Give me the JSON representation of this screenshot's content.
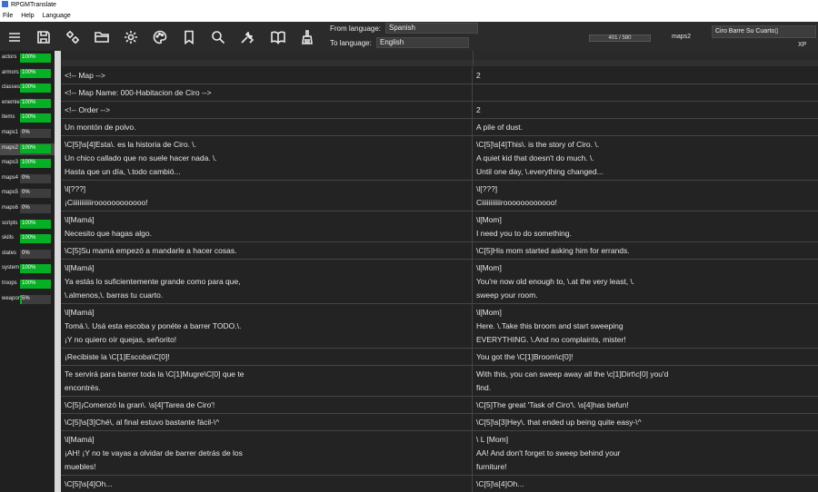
{
  "window": {
    "title": "RPGMTranslate"
  },
  "menu": [
    "File",
    "Help",
    "Language"
  ],
  "toolbar_icons": [
    "menu-icon",
    "save-icon",
    "tools-icon",
    "folder-icon",
    "gear-icon",
    "palette-icon",
    "bookmark-icon",
    "search-icon",
    "wrench-icon",
    "book-icon",
    "broom-icon"
  ],
  "language": {
    "from_label": "From language:",
    "from_value": "Spanish",
    "to_label": "To language:",
    "to_value": "English"
  },
  "progress": {
    "text": "401 / 580",
    "done": 401,
    "total": 580
  },
  "current_file": "maps2",
  "project": {
    "title": "Ciro Barre Su Cuarto▯",
    "engine": "XP"
  },
  "accent_color": "#06b025",
  "sidebar": [
    {
      "name": "actors",
      "pct": "100%",
      "value": 1.0
    },
    {
      "name": "armors",
      "pct": "100%",
      "value": 1.0
    },
    {
      "name": "classes",
      "pct": "100%",
      "value": 1.0
    },
    {
      "name": "enemies",
      "pct": "100%",
      "value": 1.0
    },
    {
      "name": "items",
      "pct": "100%",
      "value": 1.0
    },
    {
      "name": "maps1",
      "pct": "0%",
      "value": 0.0
    },
    {
      "name": "maps2",
      "pct": "100%",
      "value": 1.0,
      "selected": true
    },
    {
      "name": "maps3",
      "pct": "100%",
      "value": 1.0
    },
    {
      "name": "maps4",
      "pct": "0%",
      "value": 0.0
    },
    {
      "name": "maps5",
      "pct": "0%",
      "value": 0.0
    },
    {
      "name": "maps6",
      "pct": "0%",
      "value": 0.0
    },
    {
      "name": "scripts",
      "pct": "100%",
      "value": 1.0
    },
    {
      "name": "skills",
      "pct": "100%",
      "value": 1.0
    },
    {
      "name": "states",
      "pct": "0%",
      "value": 0.0
    },
    {
      "name": "system",
      "pct": "100%",
      "value": 1.0
    },
    {
      "name": "troops",
      "pct": "100%",
      "value": 1.0
    },
    {
      "name": "weapons",
      "pct": "5%",
      "value": 0.05
    }
  ],
  "rows": [
    {
      "source": "<!-- Map -->",
      "target": "2"
    },
    {
      "source": "<!-- Map Name: 000-Habitacion de Ciro -->",
      "target": ""
    },
    {
      "source": "<!-- Order -->",
      "target": "2"
    },
    {
      "source": "Un montón de polvo.",
      "target": "A pile of dust."
    },
    {
      "source": "\\C[5]\\s[4]Esta\\. es la historia de Ciro. \\.\nUn chico callado que no suele hacer nada. \\.\nHasta que un día, \\.todo cambió...",
      "target": "\\C[5]\\s[4]This\\. is the story of Ciro. \\.\nA quiet kid that doesn't do much. \\.\nUntil one day, \\.everything changed..."
    },
    {
      "source": "\\l[???]\n¡Ciiiiiiiiiiiroooooooooooo!",
      "target": "\\l[???]\nCiiiiiiiiiiiroooooooooooo!"
    },
    {
      "source": "\\l[Mamá]\nNecesito que hagas algo.",
      "target": "\\l[Mom]\nI need you to do something."
    },
    {
      "source": "\\C[5]Su mamá empezó a mandarle a hacer cosas.",
      "target": "\\C[5]His mom started asking him for errands."
    },
    {
      "source": "\\l[Mamá]\nYa estás lo suficientemente grande como para que,\n\\.almenos,\\. barras tu cuarto.",
      "target": "\\l[Mom]\nYou're now old enough to, \\.at the very least, \\.\nsweep your room."
    },
    {
      "source": "\\l[Mamá]\nTomá.\\. Usá esta escoba y ponéte a barrer TODO.\\.\n¡Y no quiero oír quejas, señorito!",
      "target": "\\l[Mom]\nHere. \\.Take this broom and start sweeping\nEVERYTHING. \\.And no complaints, mister!"
    },
    {
      "source": "¡Recibiste la \\C[1]Escoba\\C[0]!",
      "target": "You got the \\C[1]Broom\\c[0]!"
    },
    {
      "source": "Te servirá para barrer toda la \\C[1]Mugre\\C[0] que te\nencontrés.",
      "target": "With this, you can sweep away all the \\c[1]Dirt\\c[0] you'd\nfind."
    },
    {
      "source": "\\C[5]¡Comenzó la gran\\. \\s[4]'Tarea de Ciro'!",
      "target": "\\C[5]The great 'Task of Ciro'\\. \\s[4]has befun!"
    },
    {
      "source": "\\C[5]\\s[3]Ché\\, al final estuvo bastante fácil-\\^",
      "target": "\\C[5]\\s[3]Hey\\. that ended up being quite easy-\\^"
    },
    {
      "source": "\\l[Mamá]\n¡AH! ¡Y no te vayas a olvidar de barrer detrás de los\nmuebles!",
      "target": "\\ L [Mom]\nAA! And don't forget to sweep behind your\nfurniture!"
    },
    {
      "source": "\\C[5]\\s[4]Oh...",
      "target": "\\C[5]\\s[4]Oh..."
    }
  ]
}
